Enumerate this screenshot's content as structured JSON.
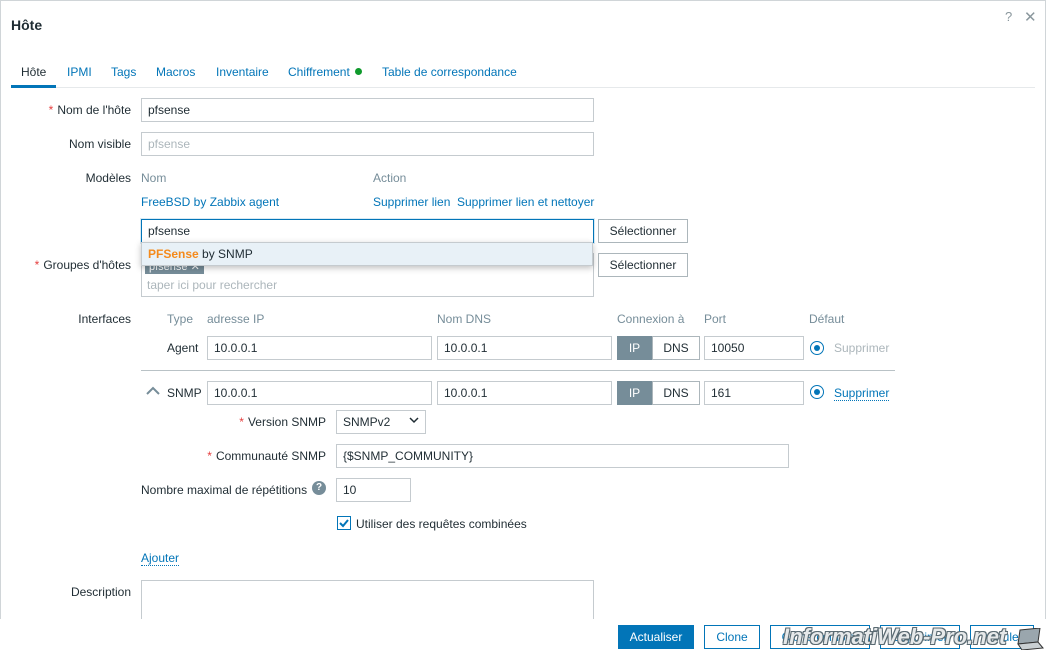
{
  "dialog": {
    "title": "Hôte",
    "help": "?",
    "close": "✕"
  },
  "tabs": [
    {
      "label": "Hôte"
    },
    {
      "label": "IPMI"
    },
    {
      "label": "Tags"
    },
    {
      "label": "Macros"
    },
    {
      "label": "Inventaire"
    },
    {
      "label": "Chiffrement"
    },
    {
      "label": "Table de correspondance"
    }
  ],
  "tab_status_color": "#0f9a2c",
  "host_name": {
    "label": "Nom de l'hôte",
    "value": "pfsense"
  },
  "visible_name": {
    "label": "Nom visible",
    "placeholder": "pfsense"
  },
  "templates": {
    "label": "Modèles",
    "col_name": "Nom",
    "col_action": "Action",
    "linked": "FreeBSD by Zabbix agent",
    "unlink": "Supprimer lien",
    "unlink_clear": "Supprimer lien et nettoyer",
    "search_value": "pfsense",
    "select_button": "Sélectionner",
    "suggestion_match": "PFSense",
    "suggestion_rest": " by SNMP"
  },
  "host_groups": {
    "label": "Groupes d'hôtes",
    "chip": "pfsense",
    "chip_remove": "✕",
    "placeholder": "taper ici pour rechercher",
    "select_button": "Sélectionner"
  },
  "interfaces": {
    "label": "Interfaces",
    "headers": {
      "type": "Type",
      "ip": "adresse IP",
      "dns": "Nom DNS",
      "connect": "Connexion à",
      "port": "Port",
      "default": "Défaut"
    },
    "agent": {
      "type": "Agent",
      "ip": "10.0.0.1",
      "dns": "10.0.0.1",
      "seg_ip": "IP",
      "seg_dns": "DNS",
      "port": "10050",
      "remove": "Supprimer"
    },
    "snmp": {
      "type": "SNMP",
      "ip": "10.0.0.1",
      "dns": "10.0.0.1",
      "seg_ip": "IP",
      "seg_dns": "DNS",
      "port": "161",
      "remove": "Supprimer"
    },
    "snmp_version_label": "Version SNMP",
    "snmp_version_value": "SNMPv2",
    "snmp_community_label": "Communauté SNMP",
    "snmp_community_value": "{$SNMP_COMMUNITY}",
    "max_rep_label": "Nombre maximal de répétitions",
    "max_rep_value": "10",
    "bulk_label": "Utiliser des requêtes combinées",
    "bulk_checked": true,
    "add_link": "Ajouter"
  },
  "description": {
    "label": "Description"
  },
  "footer": {
    "update": "Actualiser",
    "clone": "Clone",
    "full_clone": "Clone complet",
    "delete": "Supprimer",
    "cancel": "Annuler"
  },
  "watermark": "InformatiWeb-Pro.net"
}
